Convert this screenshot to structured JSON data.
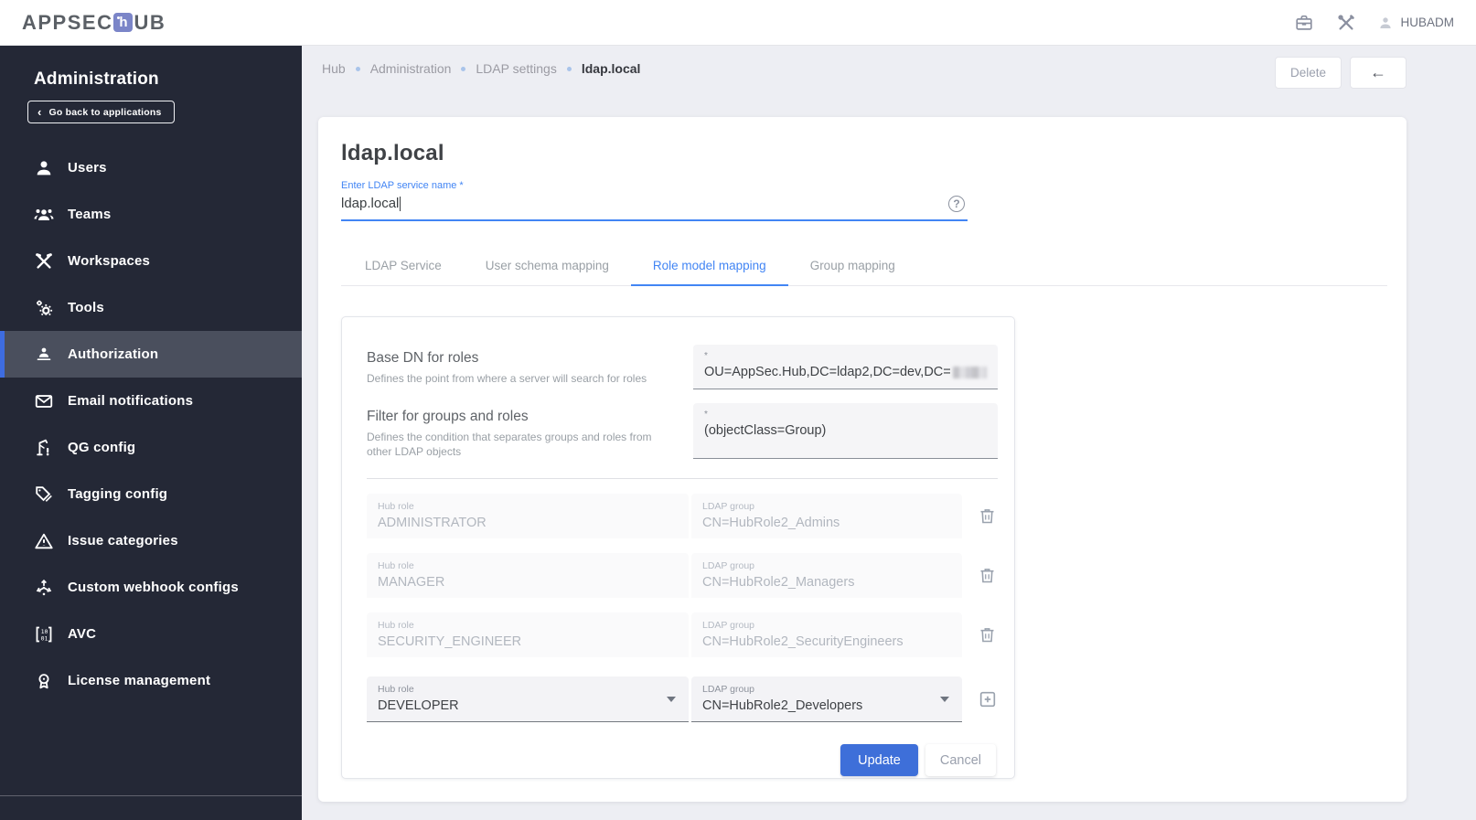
{
  "colors": {
    "accent_blue": "#4285f4",
    "primary_button_blue": "#3e6fd9",
    "sidebar_bg": "#242836",
    "sidebar_selected_bg": "#4a4f5d",
    "sidebar_selected_border": "#3e6ce0",
    "page_bg": "#edeef3",
    "logo_badge": "#7b85c8"
  },
  "icons": {
    "help": "?",
    "back_arrow": "←",
    "chevron_left": "‹",
    "logo_h": "h"
  },
  "header": {
    "logo_pre": "APPSEC",
    "logo_post": "UB",
    "user": "HUBADM"
  },
  "sidebar": {
    "title": "Administration",
    "back_button": "Go back to applications",
    "items": [
      {
        "label": "Users",
        "icon": "user-icon",
        "selected": false
      },
      {
        "label": "Teams",
        "icon": "group-icon",
        "selected": false
      },
      {
        "label": "Workspaces",
        "icon": "hammer-wrench-icon",
        "selected": false
      },
      {
        "label": "Tools",
        "icon": "gears-icon",
        "selected": false
      },
      {
        "label": "Authorization",
        "icon": "person-podium-icon",
        "selected": true
      },
      {
        "label": "Email notifications",
        "icon": "envelope-icon",
        "selected": false
      },
      {
        "label": "QG config",
        "icon": "gate-icon",
        "selected": false
      },
      {
        "label": "Tagging config",
        "icon": "tag-icon",
        "selected": false
      },
      {
        "label": "Issue categories",
        "icon": "warning-triangle-icon",
        "selected": false
      },
      {
        "label": "Custom webhook configs",
        "icon": "branch-arrows-icon",
        "selected": false
      },
      {
        "label": "AVC",
        "icon": "binary-brackets-icon",
        "selected": false
      },
      {
        "label": "License management",
        "icon": "badge-icon",
        "selected": false
      }
    ]
  },
  "breadcrumb": {
    "items": [
      "Hub",
      "Administration",
      "LDAP settings",
      "ldap.local"
    ]
  },
  "page_actions": {
    "delete": "Delete"
  },
  "main": {
    "title": "ldap.local",
    "name_field": {
      "label": "Enter LDAP service name *",
      "value": "ldap.local"
    },
    "tabs": [
      {
        "label": "LDAP Service"
      },
      {
        "label": "User schema mapping"
      },
      {
        "label": "Role model mapping"
      },
      {
        "label": "Group mapping"
      }
    ],
    "active_tab": "Role model mapping",
    "form": {
      "required_marker": "*",
      "fields": [
        {
          "name": "Base DN for roles",
          "description": "Defines the point from where a server will search for roles",
          "value": "OU=AppSec.Hub,DC=ldap2,DC=dev,DC=",
          "value_redacted_suffix": true
        },
        {
          "name": "Filter for groups and roles",
          "description": "Defines the condition that separates groups and roles from other LDAP objects",
          "value": "(objectClass=Group)",
          "value_redacted_suffix": false
        }
      ],
      "row_labels": {
        "hub_role": "Hub role",
        "ldap_group": "LDAP group"
      },
      "role_rows": [
        {
          "hub_role": "ADMINISTRATOR",
          "ldap_group": "CN=HubRole2_Admins",
          "editable": false
        },
        {
          "hub_role": "MANAGER",
          "ldap_group": "CN=HubRole2_Managers",
          "editable": false
        },
        {
          "hub_role": "SECURITY_ENGINEER",
          "ldap_group": "CN=HubRole2_SecurityEngineers",
          "editable": false
        },
        {
          "hub_role": "DEVELOPER",
          "ldap_group": "CN=HubRole2_Developers",
          "editable": true
        }
      ],
      "buttons": {
        "update": "Update",
        "cancel": "Cancel"
      }
    }
  }
}
